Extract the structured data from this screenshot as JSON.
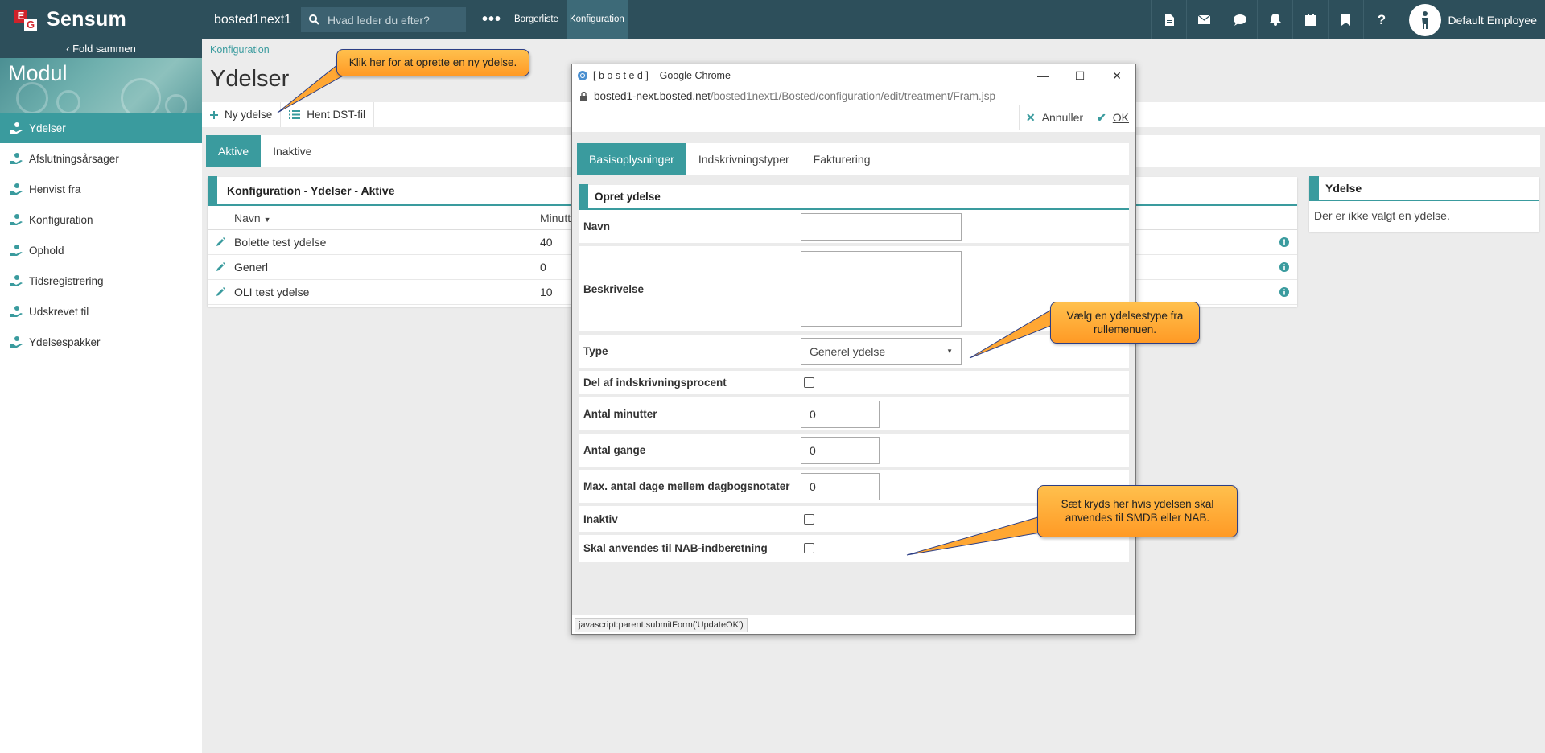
{
  "topbar": {
    "brand_e": "E",
    "brand_g": "G",
    "brand_name": "Sensum",
    "site_name": "bosted1next1",
    "search_placeholder": "Hvad leder du efter?",
    "more": "•••",
    "nav": [
      "Borgerliste",
      "Konfiguration"
    ],
    "icons": [
      "document-icon",
      "mail-icon",
      "chat-icon",
      "bell-icon",
      "calendar-icon",
      "bookmark-icon",
      "help-icon"
    ],
    "user_name": "Default Employee"
  },
  "sidebar": {
    "fold_label": "Fold sammen",
    "module_title": "Modul",
    "items": [
      {
        "label": "Ydelser",
        "active": true
      },
      {
        "label": "Afslutningsårsager",
        "active": false
      },
      {
        "label": "Henvist fra",
        "active": false
      },
      {
        "label": "Konfiguration",
        "active": false
      },
      {
        "label": "Ophold",
        "active": false
      },
      {
        "label": "Tidsregistrering",
        "active": false
      },
      {
        "label": "Udskrevet til",
        "active": false
      },
      {
        "label": "Ydelsespakker",
        "active": false
      }
    ]
  },
  "main": {
    "breadcrumb": "Konfiguration",
    "title": "Ydelser",
    "toolbar": {
      "new_label": "Ny ydelse",
      "dst_label": "Hent DST-fil"
    },
    "tabs": [
      {
        "label": "Aktive",
        "active": true
      },
      {
        "label": "Inaktive",
        "active": false
      }
    ],
    "panel_title": "Konfiguration - Ydelser - Aktive",
    "columns": {
      "name": "Navn",
      "minutes": "Minutt"
    },
    "rows": [
      {
        "name": "Bolette test ydelse",
        "minutes": "40"
      },
      {
        "name": "Generl",
        "minutes": "0"
      },
      {
        "name": "OLI test ydelse",
        "minutes": "10"
      }
    ],
    "detail_title": "Ydelse",
    "detail_empty": "Der er ikke valgt en ydelse."
  },
  "popup": {
    "window_title": "[ b o s t e d ] – Google Chrome",
    "url_host": "bosted1-next.bosted.net",
    "url_path": "/bosted1next1/Bosted/configuration/edit/treatment/Fram.jsp",
    "cancel_label": "Annuller",
    "ok_label": "OK",
    "tabs": [
      {
        "label": "Basisoplysninger",
        "active": true
      },
      {
        "label": "Indskrivningstyper",
        "active": false
      },
      {
        "label": "Fakturering",
        "active": false
      }
    ],
    "form_title": "Opret ydelse",
    "fields": {
      "navn": {
        "label": "Navn",
        "value": ""
      },
      "beskrivelse": {
        "label": "Beskrivelse",
        "value": ""
      },
      "type": {
        "label": "Type",
        "value": "Generel ydelse"
      },
      "del": {
        "label": "Del af indskrivningsprocent",
        "checked": false
      },
      "minutter": {
        "label": "Antal minutter",
        "value": "0"
      },
      "gange": {
        "label": "Antal gange",
        "value": "0"
      },
      "maxdage": {
        "label": "Max. antal dage mellem dagbogsnotater",
        "value": "0"
      },
      "inaktiv": {
        "label": "Inaktiv",
        "checked": false
      },
      "nab": {
        "label": "Skal anvendes til NAB-indberetning",
        "checked": false
      }
    },
    "status_text": "javascript:parent.submitForm('UpdateOK')"
  },
  "callouts": {
    "new": "Klik her for at oprette en ny ydelse.",
    "type_line1": "Vælg en ydelsestype fra",
    "type_line2": "rullemenuen.",
    "nab_line1": "Sæt kryds her hvis ydelsen skal",
    "nab_line2": "anvendes til SMDB eller NAB."
  },
  "colors": {
    "topbar": "#2d4f5b",
    "accent": "#3a9b9e",
    "callout": "#ffa733"
  }
}
